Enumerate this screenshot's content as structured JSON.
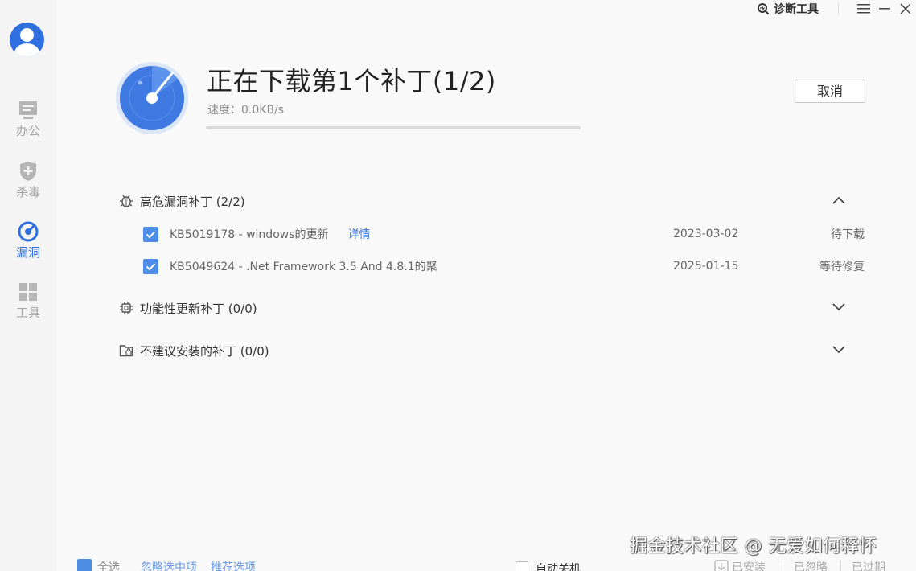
{
  "topbar": {
    "diag_label": "诊断工具"
  },
  "sidebar": {
    "items": [
      {
        "label": "办公",
        "icon": "monitor-icon",
        "active": false
      },
      {
        "label": "杀毒",
        "icon": "shield-plus-icon",
        "active": false
      },
      {
        "label": "漏洞",
        "icon": "radar-icon",
        "active": true
      },
      {
        "label": "工具",
        "icon": "grid-icon",
        "active": false
      }
    ]
  },
  "header": {
    "title": "正在下载第1个补丁(1/2)",
    "speed": "速度：0.0KB/s",
    "progress": 0,
    "cancel_label": "取消"
  },
  "sections": [
    {
      "label": "高危漏洞补丁 (2/2)",
      "icon": "bug-icon",
      "expanded": true,
      "patches": [
        {
          "name": "KB5019178 - windows的更新",
          "link": "详情",
          "date": "2023-03-02",
          "status": "待下载",
          "checked": true
        },
        {
          "name": "KB5049624 - .Net Framework 3.5 And 4.8.1的聚",
          "link": "",
          "date": "2025-01-15",
          "status": "等待修复",
          "checked": true
        }
      ]
    },
    {
      "label": "功能性更新补丁 (0/0)",
      "icon": "chip-icon",
      "expanded": false
    },
    {
      "label": "不建议安装的补丁 (0/0)",
      "icon": "folder-lock-icon",
      "expanded": false
    }
  ],
  "bottom": {
    "select_all": "全选",
    "ignore_selected": "忽略选中项",
    "recommend": "推荐选项",
    "auto_shutdown": "自动关机",
    "installed": "已安装",
    "ignored": "已忽略",
    "expired": "已过期"
  },
  "watermark": "掘金技术社区 @ 无爱如何释怀",
  "colors": {
    "accent": "#2f6fe0",
    "checkbox": "#4d8de5"
  }
}
